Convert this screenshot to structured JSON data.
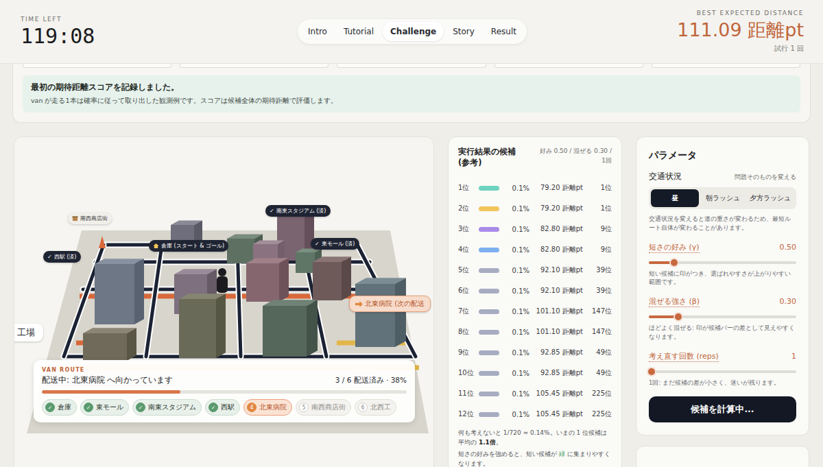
{
  "header": {
    "timer_label": "TIME LEFT",
    "timer": "119:08",
    "score_label": "BEST EXPECTED DISTANCE",
    "score": "111.09 距離pt",
    "attempts": "試行 1 回"
  },
  "tabs": [
    {
      "label": "Intro",
      "selected": false
    },
    {
      "label": "Tutorial",
      "selected": false
    },
    {
      "label": "Challenge",
      "selected": true
    },
    {
      "label": "Story",
      "selected": false
    },
    {
      "label": "Result",
      "selected": false
    }
  ],
  "notice": {
    "title": "最初の期待距離スコアを記録しました。",
    "body": "van が走る1本は確率に従って取り出した観測例です。スコアは候補全体の期待距離で評価します。"
  },
  "map": {
    "labels": [
      {
        "text": "南西商店街",
        "kind": "shop",
        "mark": ""
      },
      {
        "text": "南東スタジアム (済)",
        "kind": "done",
        "mark": "✓"
      },
      {
        "text": "西駅 (済)",
        "kind": "done",
        "mark": "✓"
      },
      {
        "text": "倉庫 (スタート & ゴール)",
        "kind": "home",
        "mark": ""
      },
      {
        "text": "東モール (済)",
        "kind": "done",
        "mark": "✓"
      },
      {
        "text": "北東病院 (次の配送",
        "kind": "next",
        "mark": ""
      },
      {
        "text": "工場",
        "kind": "plain",
        "mark": ""
      }
    ]
  },
  "van_route": {
    "label": "VAN ROUTE",
    "status": "配送中: 北東病院 へ向かっています",
    "progress_text": "3 / 6 配送済み · 38%",
    "level": 0.38,
    "stops": [
      {
        "mark": "✓",
        "name": "倉庫",
        "done": true,
        "current": false
      },
      {
        "mark": "✓",
        "name": "東モール",
        "done": true,
        "current": false
      },
      {
        "mark": "✓",
        "name": "南東スタジアム",
        "done": true,
        "current": false
      },
      {
        "mark": "✓",
        "name": "西駅",
        "done": true,
        "current": false
      },
      {
        "mark": "4",
        "name": "北東病院",
        "done": false,
        "current": true
      },
      {
        "mark": "5",
        "name": "南西商店街",
        "done": false,
        "current": false
      },
      {
        "mark": "6",
        "name": "北西工",
        "done": false,
        "current": false
      }
    ]
  },
  "candidates": {
    "title": "実行結果の候補 (参考)",
    "meta": "好み 0.50 / 混ぜる 0.30 / 1回",
    "rows": [
      {
        "rank": "1位",
        "color": "#6dd3bf",
        "share": "0.1%",
        "distance": "79.20 距離pt",
        "true_rank": "1位"
      },
      {
        "rank": "2位",
        "color": "#f2c55c",
        "share": "0.1%",
        "distance": "79.20 距離pt",
        "true_rank": "1位"
      },
      {
        "rank": "3位",
        "color": "#a98be8",
        "share": "0.1%",
        "distance": "82.80 距離pt",
        "true_rank": "9位"
      },
      {
        "rank": "4位",
        "color": "#7eb0f0",
        "share": "0.1%",
        "distance": "82.80 距離pt",
        "true_rank": "9位"
      },
      {
        "rank": "5位",
        "color": "#a8acc2",
        "share": "0.1%",
        "distance": "92.10 距離pt",
        "true_rank": "39位"
      },
      {
        "rank": "6位",
        "color": "#a8acc2",
        "share": "0.1%",
        "distance": "92.10 距離pt",
        "true_rank": "39位"
      },
      {
        "rank": "7位",
        "color": "#a8acc2",
        "share": "0.1%",
        "distance": "101.10 距離pt",
        "true_rank": "147位"
      },
      {
        "rank": "8位",
        "color": "#a8acc2",
        "share": "0.1%",
        "distance": "101.10 距離pt",
        "true_rank": "147位"
      },
      {
        "rank": "9位",
        "color": "#a8acc2",
        "share": "0.1%",
        "distance": "92.85 距離pt",
        "true_rank": "49位"
      },
      {
        "rank": "10位",
        "color": "#a8acc2",
        "share": "0.1%",
        "distance": "92.85 距離pt",
        "true_rank": "49位"
      },
      {
        "rank": "11位",
        "color": "#a8acc2",
        "share": "0.1%",
        "distance": "105.45 距離pt",
        "true_rank": "225位"
      },
      {
        "rank": "12位",
        "color": "#a8acc2",
        "share": "0.1%",
        "distance": "105.45 距離pt",
        "true_rank": "225位"
      }
    ],
    "footer": [
      [
        {
          "text": "何も考えないと 1/720 ≈ 0.14%。いまの 1 位候補は平均の ",
          "kind": "plain"
        },
        {
          "text": "1.1倍",
          "kind": "bold"
        },
        {
          "text": "。",
          "kind": "plain"
        }
      ],
      [
        {
          "text": "短さの好みを強めると、短い候補が ",
          "kind": "plain"
        },
        {
          "text": "緑",
          "kind": "green"
        },
        {
          "text": " に集まりやすくなります。",
          "kind": "plain"
        }
      ]
    ]
  },
  "params": {
    "title": "パラメータ",
    "traffic": {
      "label": "交通状況",
      "hint": "問題そのものを変える",
      "options": [
        {
          "label": "昼",
          "selected": true
        },
        {
          "label": "朝ラッシュ",
          "selected": false
        },
        {
          "label": "夕方ラッシュ",
          "selected": false
        }
      ],
      "note": "交通状況を変えると道の重さが変わるため、最短ルート自体が変わることがあります。"
    },
    "sliders": [
      {
        "label": "短さの好み (γ)",
        "value": "0.50",
        "level": 0.17,
        "note": "短い候補に印がつき、選ばれやすさが上がりやすい範囲です。"
      },
      {
        "label": "混ぜる強さ (β)",
        "value": "0.30",
        "level": 0.2,
        "note": "ほどよく混ぜる: 印が候補バーの差として見えやすくなります。"
      },
      {
        "label": "考え直す回数 (reps)",
        "value": "1",
        "level": 0.02,
        "note": "1回: まだ候補の差が小さく、迷いが残ります。"
      }
    ],
    "button": "候補を計算中..."
  }
}
